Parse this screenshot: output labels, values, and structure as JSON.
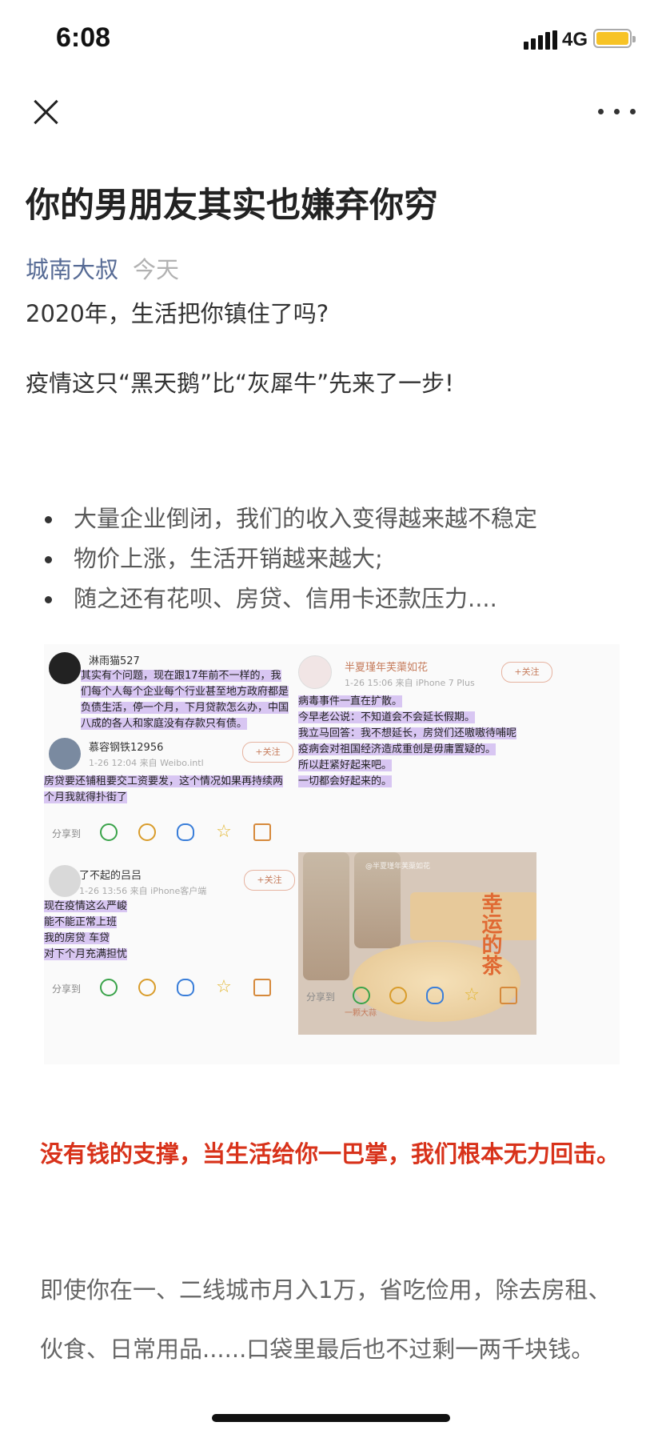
{
  "status": {
    "time": "6:08",
    "network": "4G"
  },
  "article": {
    "title": "你的男朋友其实也嫌弃你穷",
    "author": "城南大叔",
    "date": "今天",
    "p1": "2020年，生活把你镇住了吗?",
    "p2": "疫情这只“黑天鹅”比“灰犀牛”先来了一步!",
    "bullets": [
      "大量企业倒闭，我们的收入变得越来越不稳定",
      "物价上涨，生活开销越来越大;",
      "随之还有花呗、房贷、信用卡还款压力...."
    ],
    "red_text": "没有钱的支撑，当生活给你一巴掌，我们根本无力回击。",
    "gray_text": "即使你在一、二线城市月入1万，省吃俭用，除去房租、伙食、日常用品......口袋里最后也不过剩一两千块钱。"
  },
  "collage": {
    "post1": {
      "name": "淋雨猫527",
      "text": "其实有个问题，现在跟17年前不一样的，我们每个人每个企业每个行业甚至地方政府都是负债生活，停一个月，下月贷款怎么办，中国八成的各人和家庭没有存款只有债。"
    },
    "post2": {
      "name": "慕容钢铁12956",
      "meta": "1-26 12:04  来自 Weibo.intl",
      "text": "房贷要还铺租要交工资要发，这个情况如果再持续两个月我就得扑街了",
      "follow": "+关注"
    },
    "post3": {
      "name": "了不起的吕吕",
      "meta": "1-26 13:56  来自 iPhone客户端",
      "lines": [
        "现在疫情这么严峻",
        "能不能正常上班",
        "我的房贷 车贷",
        "对下个月充满担忧"
      ],
      "follow": "+关注"
    },
    "post4": {
      "name": "半夏瑾年芙蕖如花",
      "meta": "1-26 15:06  来自 iPhone 7 Plus",
      "lines": [
        "病毒事件一直在扩散。",
        "今早老公说：不知道会不会延长假期。",
        "我立马回答：我不想延长，房贷们还嗷嗷待哺呢",
        "疫病会对祖国经济造成重创是毋庸置疑的。",
        "所以赶紧好起来吧。",
        "一切都会好起来的。"
      ],
      "follow": "+关注",
      "photo_caption": "幸运的茶",
      "photo_small": "一颗大蒜",
      "photo_wm": "@半夏瑾年芙蕖如花"
    },
    "share_label": "分享到"
  },
  "colors": {
    "author": "#576b95",
    "red_text": "#d8321a",
    "highlight": "#d8c6f2"
  }
}
